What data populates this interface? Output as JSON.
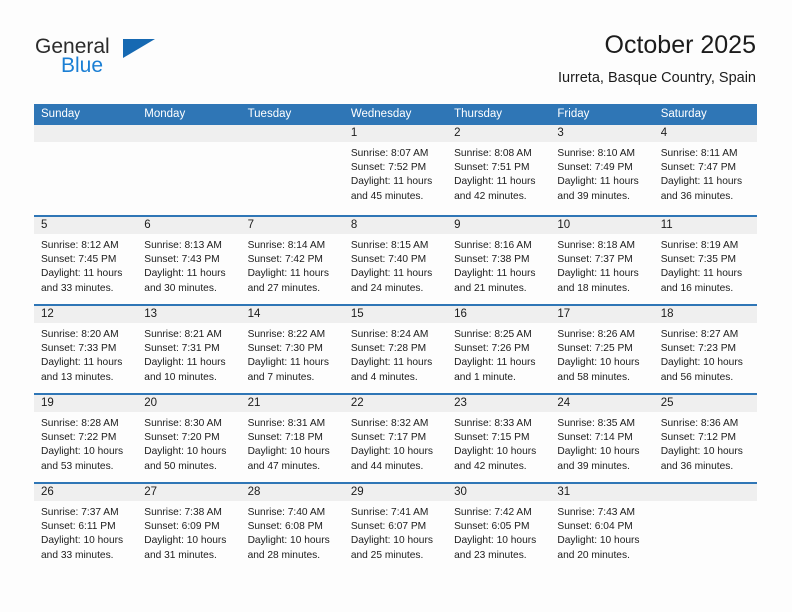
{
  "brand": {
    "general": "General",
    "blue": "Blue",
    "triangle_color": "#1669b2"
  },
  "header": {
    "title": "October 2025",
    "subtitle": "Iurreta, Basque Country, Spain"
  },
  "theme": {
    "header_blue": "#2f76b6",
    "band_gray": "#efefef",
    "text": "#1c1c1c"
  },
  "weekday_headers": [
    "Sunday",
    "Monday",
    "Tuesday",
    "Wednesday",
    "Thursday",
    "Friday",
    "Saturday"
  ],
  "weeks": [
    [
      {
        "day": "",
        "sunrise": "",
        "sunset": "",
        "daylight_1": "",
        "daylight_2": ""
      },
      {
        "day": "",
        "sunrise": "",
        "sunset": "",
        "daylight_1": "",
        "daylight_2": ""
      },
      {
        "day": "",
        "sunrise": "",
        "sunset": "",
        "daylight_1": "",
        "daylight_2": ""
      },
      {
        "day": "1",
        "sunrise": "Sunrise: 8:07 AM",
        "sunset": "Sunset: 7:52 PM",
        "daylight_1": "Daylight: 11 hours",
        "daylight_2": "and 45 minutes."
      },
      {
        "day": "2",
        "sunrise": "Sunrise: 8:08 AM",
        "sunset": "Sunset: 7:51 PM",
        "daylight_1": "Daylight: 11 hours",
        "daylight_2": "and 42 minutes."
      },
      {
        "day": "3",
        "sunrise": "Sunrise: 8:10 AM",
        "sunset": "Sunset: 7:49 PM",
        "daylight_1": "Daylight: 11 hours",
        "daylight_2": "and 39 minutes."
      },
      {
        "day": "4",
        "sunrise": "Sunrise: 8:11 AM",
        "sunset": "Sunset: 7:47 PM",
        "daylight_1": "Daylight: 11 hours",
        "daylight_2": "and 36 minutes."
      }
    ],
    [
      {
        "day": "5",
        "sunrise": "Sunrise: 8:12 AM",
        "sunset": "Sunset: 7:45 PM",
        "daylight_1": "Daylight: 11 hours",
        "daylight_2": "and 33 minutes."
      },
      {
        "day": "6",
        "sunrise": "Sunrise: 8:13 AM",
        "sunset": "Sunset: 7:43 PM",
        "daylight_1": "Daylight: 11 hours",
        "daylight_2": "and 30 minutes."
      },
      {
        "day": "7",
        "sunrise": "Sunrise: 8:14 AM",
        "sunset": "Sunset: 7:42 PM",
        "daylight_1": "Daylight: 11 hours",
        "daylight_2": "and 27 minutes."
      },
      {
        "day": "8",
        "sunrise": "Sunrise: 8:15 AM",
        "sunset": "Sunset: 7:40 PM",
        "daylight_1": "Daylight: 11 hours",
        "daylight_2": "and 24 minutes."
      },
      {
        "day": "9",
        "sunrise": "Sunrise: 8:16 AM",
        "sunset": "Sunset: 7:38 PM",
        "daylight_1": "Daylight: 11 hours",
        "daylight_2": "and 21 minutes."
      },
      {
        "day": "10",
        "sunrise": "Sunrise: 8:18 AM",
        "sunset": "Sunset: 7:37 PM",
        "daylight_1": "Daylight: 11 hours",
        "daylight_2": "and 18 minutes."
      },
      {
        "day": "11",
        "sunrise": "Sunrise: 8:19 AM",
        "sunset": "Sunset: 7:35 PM",
        "daylight_1": "Daylight: 11 hours",
        "daylight_2": "and 16 minutes."
      }
    ],
    [
      {
        "day": "12",
        "sunrise": "Sunrise: 8:20 AM",
        "sunset": "Sunset: 7:33 PM",
        "daylight_1": "Daylight: 11 hours",
        "daylight_2": "and 13 minutes."
      },
      {
        "day": "13",
        "sunrise": "Sunrise: 8:21 AM",
        "sunset": "Sunset: 7:31 PM",
        "daylight_1": "Daylight: 11 hours",
        "daylight_2": "and 10 minutes."
      },
      {
        "day": "14",
        "sunrise": "Sunrise: 8:22 AM",
        "sunset": "Sunset: 7:30 PM",
        "daylight_1": "Daylight: 11 hours",
        "daylight_2": "and 7 minutes."
      },
      {
        "day": "15",
        "sunrise": "Sunrise: 8:24 AM",
        "sunset": "Sunset: 7:28 PM",
        "daylight_1": "Daylight: 11 hours",
        "daylight_2": "and 4 minutes."
      },
      {
        "day": "16",
        "sunrise": "Sunrise: 8:25 AM",
        "sunset": "Sunset: 7:26 PM",
        "daylight_1": "Daylight: 11 hours",
        "daylight_2": "and 1 minute."
      },
      {
        "day": "17",
        "sunrise": "Sunrise: 8:26 AM",
        "sunset": "Sunset: 7:25 PM",
        "daylight_1": "Daylight: 10 hours",
        "daylight_2": "and 58 minutes."
      },
      {
        "day": "18",
        "sunrise": "Sunrise: 8:27 AM",
        "sunset": "Sunset: 7:23 PM",
        "daylight_1": "Daylight: 10 hours",
        "daylight_2": "and 56 minutes."
      }
    ],
    [
      {
        "day": "19",
        "sunrise": "Sunrise: 8:28 AM",
        "sunset": "Sunset: 7:22 PM",
        "daylight_1": "Daylight: 10 hours",
        "daylight_2": "and 53 minutes."
      },
      {
        "day": "20",
        "sunrise": "Sunrise: 8:30 AM",
        "sunset": "Sunset: 7:20 PM",
        "daylight_1": "Daylight: 10 hours",
        "daylight_2": "and 50 minutes."
      },
      {
        "day": "21",
        "sunrise": "Sunrise: 8:31 AM",
        "sunset": "Sunset: 7:18 PM",
        "daylight_1": "Daylight: 10 hours",
        "daylight_2": "and 47 minutes."
      },
      {
        "day": "22",
        "sunrise": "Sunrise: 8:32 AM",
        "sunset": "Sunset: 7:17 PM",
        "daylight_1": "Daylight: 10 hours",
        "daylight_2": "and 44 minutes."
      },
      {
        "day": "23",
        "sunrise": "Sunrise: 8:33 AM",
        "sunset": "Sunset: 7:15 PM",
        "daylight_1": "Daylight: 10 hours",
        "daylight_2": "and 42 minutes."
      },
      {
        "day": "24",
        "sunrise": "Sunrise: 8:35 AM",
        "sunset": "Sunset: 7:14 PM",
        "daylight_1": "Daylight: 10 hours",
        "daylight_2": "and 39 minutes."
      },
      {
        "day": "25",
        "sunrise": "Sunrise: 8:36 AM",
        "sunset": "Sunset: 7:12 PM",
        "daylight_1": "Daylight: 10 hours",
        "daylight_2": "and 36 minutes."
      }
    ],
    [
      {
        "day": "26",
        "sunrise": "Sunrise: 7:37 AM",
        "sunset": "Sunset: 6:11 PM",
        "daylight_1": "Daylight: 10 hours",
        "daylight_2": "and 33 minutes."
      },
      {
        "day": "27",
        "sunrise": "Sunrise: 7:38 AM",
        "sunset": "Sunset: 6:09 PM",
        "daylight_1": "Daylight: 10 hours",
        "daylight_2": "and 31 minutes."
      },
      {
        "day": "28",
        "sunrise": "Sunrise: 7:40 AM",
        "sunset": "Sunset: 6:08 PM",
        "daylight_1": "Daylight: 10 hours",
        "daylight_2": "and 28 minutes."
      },
      {
        "day": "29",
        "sunrise": "Sunrise: 7:41 AM",
        "sunset": "Sunset: 6:07 PM",
        "daylight_1": "Daylight: 10 hours",
        "daylight_2": "and 25 minutes."
      },
      {
        "day": "30",
        "sunrise": "Sunrise: 7:42 AM",
        "sunset": "Sunset: 6:05 PM",
        "daylight_1": "Daylight: 10 hours",
        "daylight_2": "and 23 minutes."
      },
      {
        "day": "31",
        "sunrise": "Sunrise: 7:43 AM",
        "sunset": "Sunset: 6:04 PM",
        "daylight_1": "Daylight: 10 hours",
        "daylight_2": "and 20 minutes."
      },
      {
        "day": "",
        "sunrise": "",
        "sunset": "",
        "daylight_1": "",
        "daylight_2": ""
      }
    ]
  ]
}
